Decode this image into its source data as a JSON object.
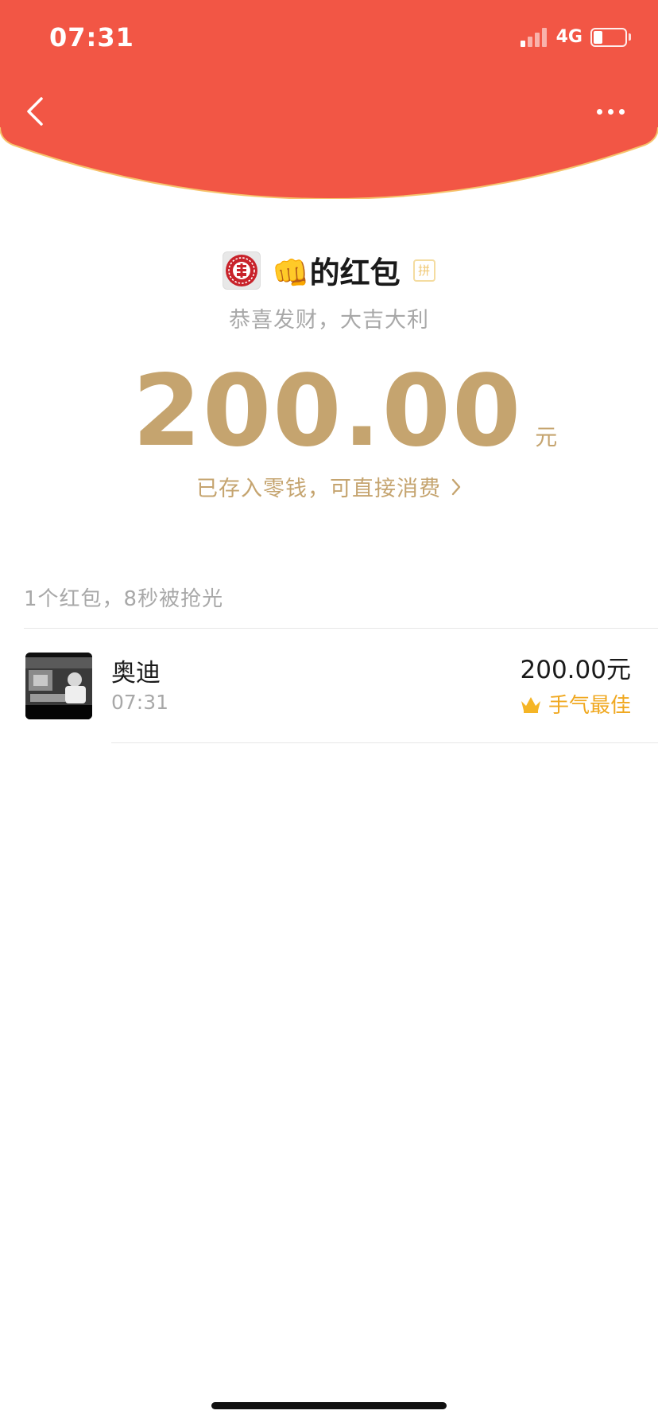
{
  "status_bar": {
    "time": "07:31",
    "network": "4G",
    "signal_bars_active": 1,
    "battery_level": 0.3
  },
  "header": {
    "bg_color": "#f25645",
    "back_icon": "chevron-left-icon",
    "more_icon": "ellipsis-icon"
  },
  "sender": {
    "name": "👊的红包",
    "pin_badge": "拼",
    "blessing": "恭喜发财，大吉大利"
  },
  "amount": {
    "value": "200.00",
    "unit": "元"
  },
  "wallet_link": {
    "label": "已存入零钱，可直接消费"
  },
  "summary": "1个红包，8秒被抢光",
  "receivers": [
    {
      "name": "奥迪",
      "time": "07:31",
      "amount": "200.00元",
      "badge": "手气最佳"
    }
  ],
  "colors": {
    "accent_gold": "#c5a46f",
    "best_luck": "#f0a820"
  }
}
